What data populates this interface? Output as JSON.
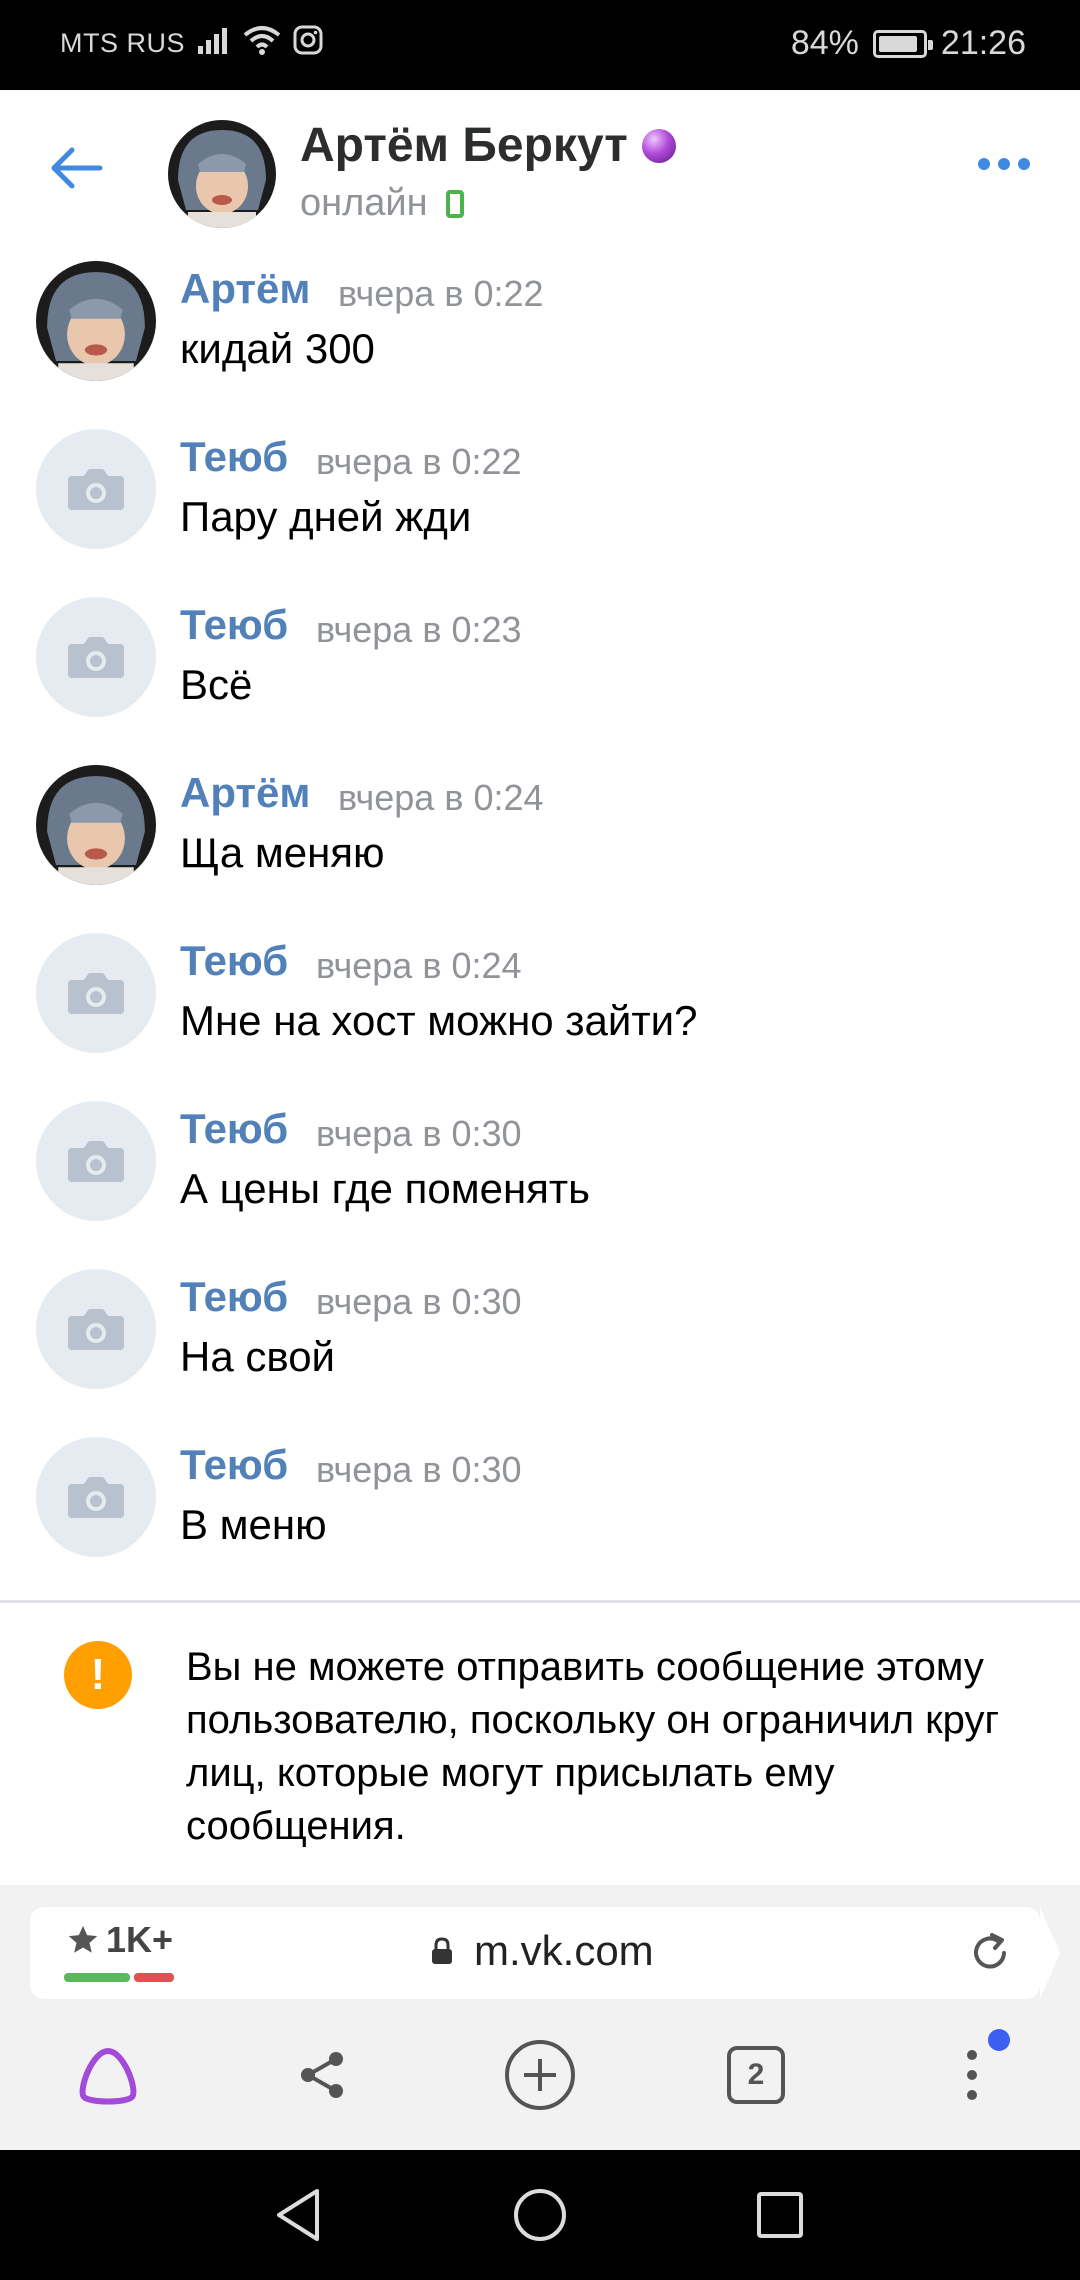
{
  "status_bar": {
    "carrier": "MTS RUS",
    "battery": "84%",
    "time": "21:26"
  },
  "header": {
    "name": "Артём Беркут",
    "status": "онлайн"
  },
  "messages": [
    {
      "author": "Артём",
      "time": "вчера в 0:22",
      "text": "кидай 300",
      "avatar": "photo"
    },
    {
      "author": "Теюб",
      "time": "вчера в 0:22",
      "text": "Пару дней жди",
      "avatar": "camera-icon"
    },
    {
      "author": "Теюб",
      "time": "вчера в 0:23",
      "text": "Всё",
      "avatar": "camera-icon"
    },
    {
      "author": "Артём",
      "time": "вчера в 0:24",
      "text": "Ща меняю",
      "avatar": "photo"
    },
    {
      "author": "Теюб",
      "time": "вчера в 0:24",
      "text": "Мне на хост можно зайти?",
      "avatar": "camera-icon"
    },
    {
      "author": "Теюб",
      "time": "вчера в 0:30",
      "text": "А цены где поменять",
      "avatar": "camera-icon"
    },
    {
      "author": "Теюб",
      "time": "вчера в 0:30",
      "text": "На свой",
      "avatar": "camera-icon"
    },
    {
      "author": "Теюб",
      "time": "вчера в 0:30",
      "text": "В меню",
      "avatar": "camera-icon"
    }
  ],
  "notice": {
    "text": "Вы не можете отправить сообщение этому пользователю, поскольку он ограничил круг лиц, которые могут присылать ему сообщения."
  },
  "browser": {
    "rating": "1K+",
    "url": "m.vk.com",
    "tabs_count": "2"
  },
  "colors": {
    "accent": "#5181b8",
    "link_blue": "#3f8ae0",
    "warning": "#ffa000",
    "online": "#4bb34b",
    "alice_purple": "#a34bd8"
  }
}
